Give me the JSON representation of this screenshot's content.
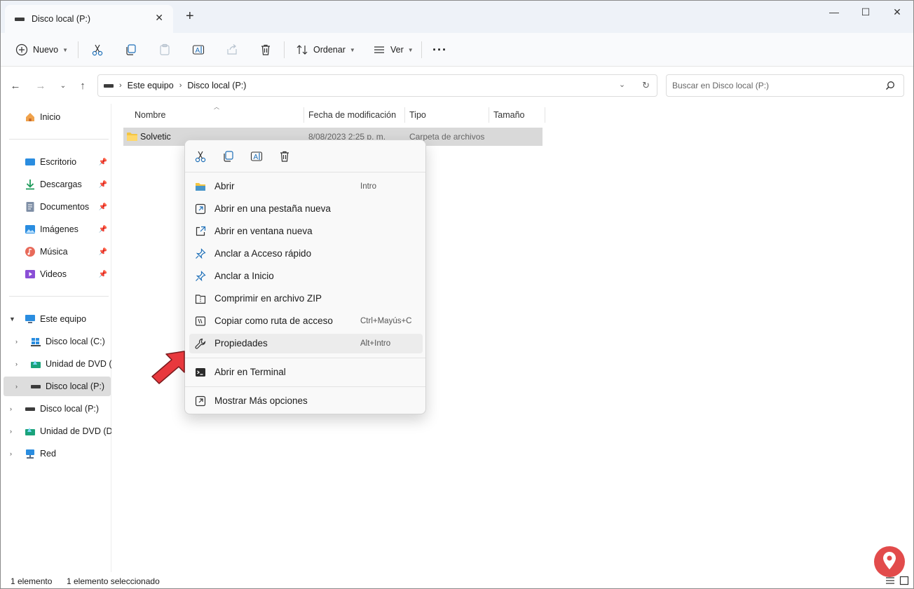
{
  "tab": {
    "title": "Disco local (P:)",
    "close": "✕",
    "new_tab": "+"
  },
  "window_controls": {
    "minimize": "—",
    "maximize": "☐",
    "close": "✕"
  },
  "toolbar": {
    "new_label": "Nuevo",
    "sort_label": "Ordenar",
    "view_label": "Ver",
    "more": "···"
  },
  "address": {
    "crumbs": [
      "Este equipo",
      "Disco local (P:)"
    ],
    "separator": "›"
  },
  "search": {
    "placeholder": "Buscar en Disco local (P:)"
  },
  "sidebar": {
    "home": "Inicio",
    "pinned": [
      {
        "label": "Escritorio",
        "icon": "desktop-icon"
      },
      {
        "label": "Descargas",
        "icon": "download-icon"
      },
      {
        "label": "Documentos",
        "icon": "documents-icon"
      },
      {
        "label": "Imágenes",
        "icon": "pictures-icon"
      },
      {
        "label": "Música",
        "icon": "music-icon"
      },
      {
        "label": "Videos",
        "icon": "videos-icon"
      }
    ],
    "this_pc": "Este equipo",
    "drives": [
      "Disco local (C:)",
      "Unidad de DVD (D:)",
      "Disco local (P:)"
    ],
    "roots": [
      "Disco local (P:)",
      "Unidad de DVD (D:)",
      "Red"
    ]
  },
  "columns": {
    "name": "Nombre",
    "modified": "Fecha de modificación",
    "type": "Tipo",
    "size": "Tamaño"
  },
  "files": [
    {
      "name": "Solvetic",
      "modified": "8/08/2023 2:25 p. m.",
      "type": "Carpeta de archivos",
      "size": ""
    }
  ],
  "context_menu": {
    "items": [
      {
        "label": "Abrir",
        "shortcut": "Intro",
        "icon": "folder-open-icon"
      },
      {
        "label": "Abrir en una pestaña nueva",
        "shortcut": "",
        "icon": "new-tab-icon"
      },
      {
        "label": "Abrir en ventana nueva",
        "shortcut": "",
        "icon": "new-window-icon"
      },
      {
        "label": "Anclar a Acceso rápido",
        "shortcut": "",
        "icon": "pin-icon"
      },
      {
        "label": "Anclar a Inicio",
        "shortcut": "",
        "icon": "pin-start-icon"
      },
      {
        "label": "Comprimir en archivo ZIP",
        "shortcut": "",
        "icon": "zip-icon"
      },
      {
        "label": "Copiar como ruta de acceso",
        "shortcut": "Ctrl+Mayús+C",
        "icon": "copy-path-icon"
      },
      {
        "label": "Propiedades",
        "shortcut": "Alt+Intro",
        "icon": "wrench-icon"
      },
      {
        "label": "Abrir en Terminal",
        "shortcut": "",
        "icon": "terminal-icon"
      },
      {
        "label": "Mostrar Más opciones",
        "shortcut": "",
        "icon": "more-options-icon"
      }
    ]
  },
  "status": {
    "count": "1 elemento",
    "selected": "1 elemento seleccionado"
  },
  "colors": {
    "accent": "#0067c0",
    "pointer_arrow": "#e8383d",
    "folder": "#f4c542",
    "watermark": "#e24b4b"
  }
}
